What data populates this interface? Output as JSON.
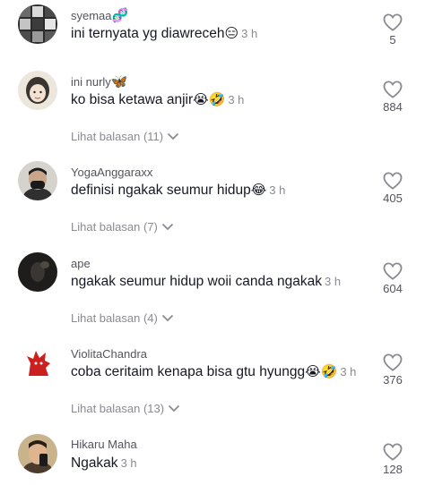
{
  "comments": [
    {
      "username": "syemaa",
      "username_emoji": "🧬",
      "text": "ini ternyata yg diawreceh",
      "text_emoji": "😑",
      "time": "3 h",
      "likes": "5",
      "avatar_icon": "photo-collage-avatar"
    },
    {
      "username": "ini nurly",
      "username_emoji": "🦋",
      "text": "ko bisa ketawa anjir",
      "text_emoji": "😭🤣",
      "time": "3 h",
      "likes": "884",
      "replies": "Lihat balasan (11)",
      "avatar_icon": "girl-avatar"
    },
    {
      "username": "YogaAnggaraxx",
      "username_emoji": "",
      "text": "definisi ngakak seumur hidup",
      "text_emoji": "😂",
      "time": "3 h",
      "likes": "405",
      "replies": "Lihat balasan (7)",
      "avatar_icon": "man-mask-avatar"
    },
    {
      "username": "ape",
      "username_emoji": "",
      "text": "ngakak seumur hidup woii canda ngakak",
      "text_emoji": "",
      "time": "3 h",
      "likes": "604",
      "replies": "Lihat balasan (4)",
      "avatar_icon": "dark-photo-avatar"
    },
    {
      "username": "ViolitaChandra",
      "username_emoji": "",
      "text": "coba ceritaim kenapa bisa gtu hyungg",
      "text_emoji": "😭🤣",
      "time": "3 h",
      "likes": "376",
      "replies": "Lihat balasan (13)",
      "avatar_icon": "red-monster-avatar"
    },
    {
      "username": "Hikaru Maha",
      "username_emoji": "",
      "text": "Ngakak",
      "text_emoji": "",
      "time": "3 h",
      "likes": "128",
      "avatar_icon": "selfie-avatar"
    }
  ],
  "colors": {
    "text": "#161823",
    "muted": "#8a8b91",
    "username": "#53545c",
    "icon": "#8a8b91"
  }
}
